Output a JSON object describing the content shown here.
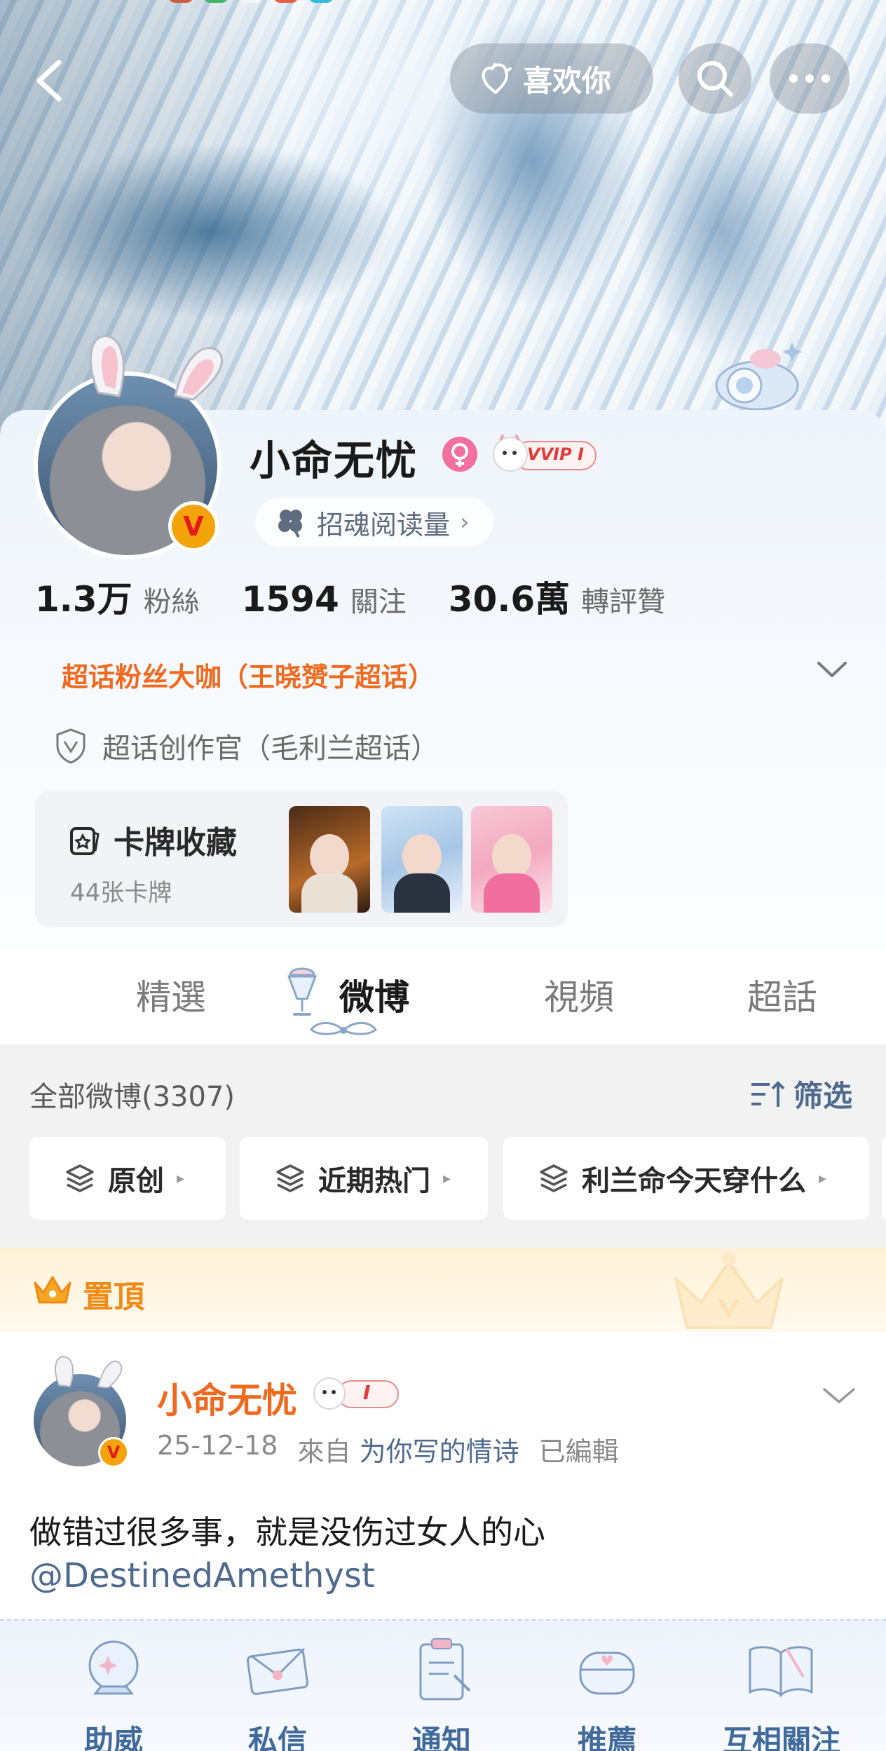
{
  "header": {
    "like_label": "喜欢你"
  },
  "profile": {
    "username": "小命无忧",
    "vip_label": "VVIP I",
    "read_chip_label": "招魂阅读量",
    "read_chip_chevron": "›",
    "verify_mark": "V",
    "stats": [
      {
        "num": "1.3万",
        "label": "粉絲"
      },
      {
        "num": "1594",
        "label": "關注"
      },
      {
        "num": "30.6萬",
        "label": "轉評贊"
      }
    ],
    "fan_title": "超话粉丝大咖（王晓赟子超话）",
    "creator_title": "超话创作官（毛利兰超话）",
    "card_collection": {
      "title": "卡牌收藏",
      "count": "44张卡牌"
    }
  },
  "tabs": [
    {
      "label": "精選",
      "active": false
    },
    {
      "label": "微博",
      "active": true
    },
    {
      "label": "視頻",
      "active": false
    },
    {
      "label": "超話",
      "active": false
    }
  ],
  "list": {
    "all_label": "全部微博(3307)",
    "filter_label": "筛选",
    "chips": [
      {
        "label": "原创",
        "arrow": "▸"
      },
      {
        "label": "近期热门",
        "arrow": "▸"
      },
      {
        "label": "利兰命今天穿什么",
        "arrow": "▸"
      }
    ]
  },
  "pinned_label": "置頂",
  "post": {
    "author": "小命无忧",
    "verify_mark": "V",
    "badge_text": "I",
    "date": "25-12-18",
    "from_label": "來自",
    "source": "为你写的情诗",
    "edited_label": "已編輯",
    "text": "做错过很多事，就是没伤过女人的心",
    "mention": "@DestinedAmethyst"
  },
  "bottom_nav": [
    {
      "label": "助威",
      "icon": "crystal-ball-icon"
    },
    {
      "label": "私信",
      "icon": "envelope-icon"
    },
    {
      "label": "通知",
      "icon": "clipboard-icon"
    },
    {
      "label": "推薦",
      "icon": "earbuds-case-icon"
    },
    {
      "label": "互相關注",
      "icon": "open-book-icon"
    }
  ],
  "colors": {
    "accent_orange": "#ef6a1e",
    "link_blue": "#4f6a8f",
    "nav_blue": "#3f6a9a",
    "verify_gold": "#f4a40a"
  }
}
